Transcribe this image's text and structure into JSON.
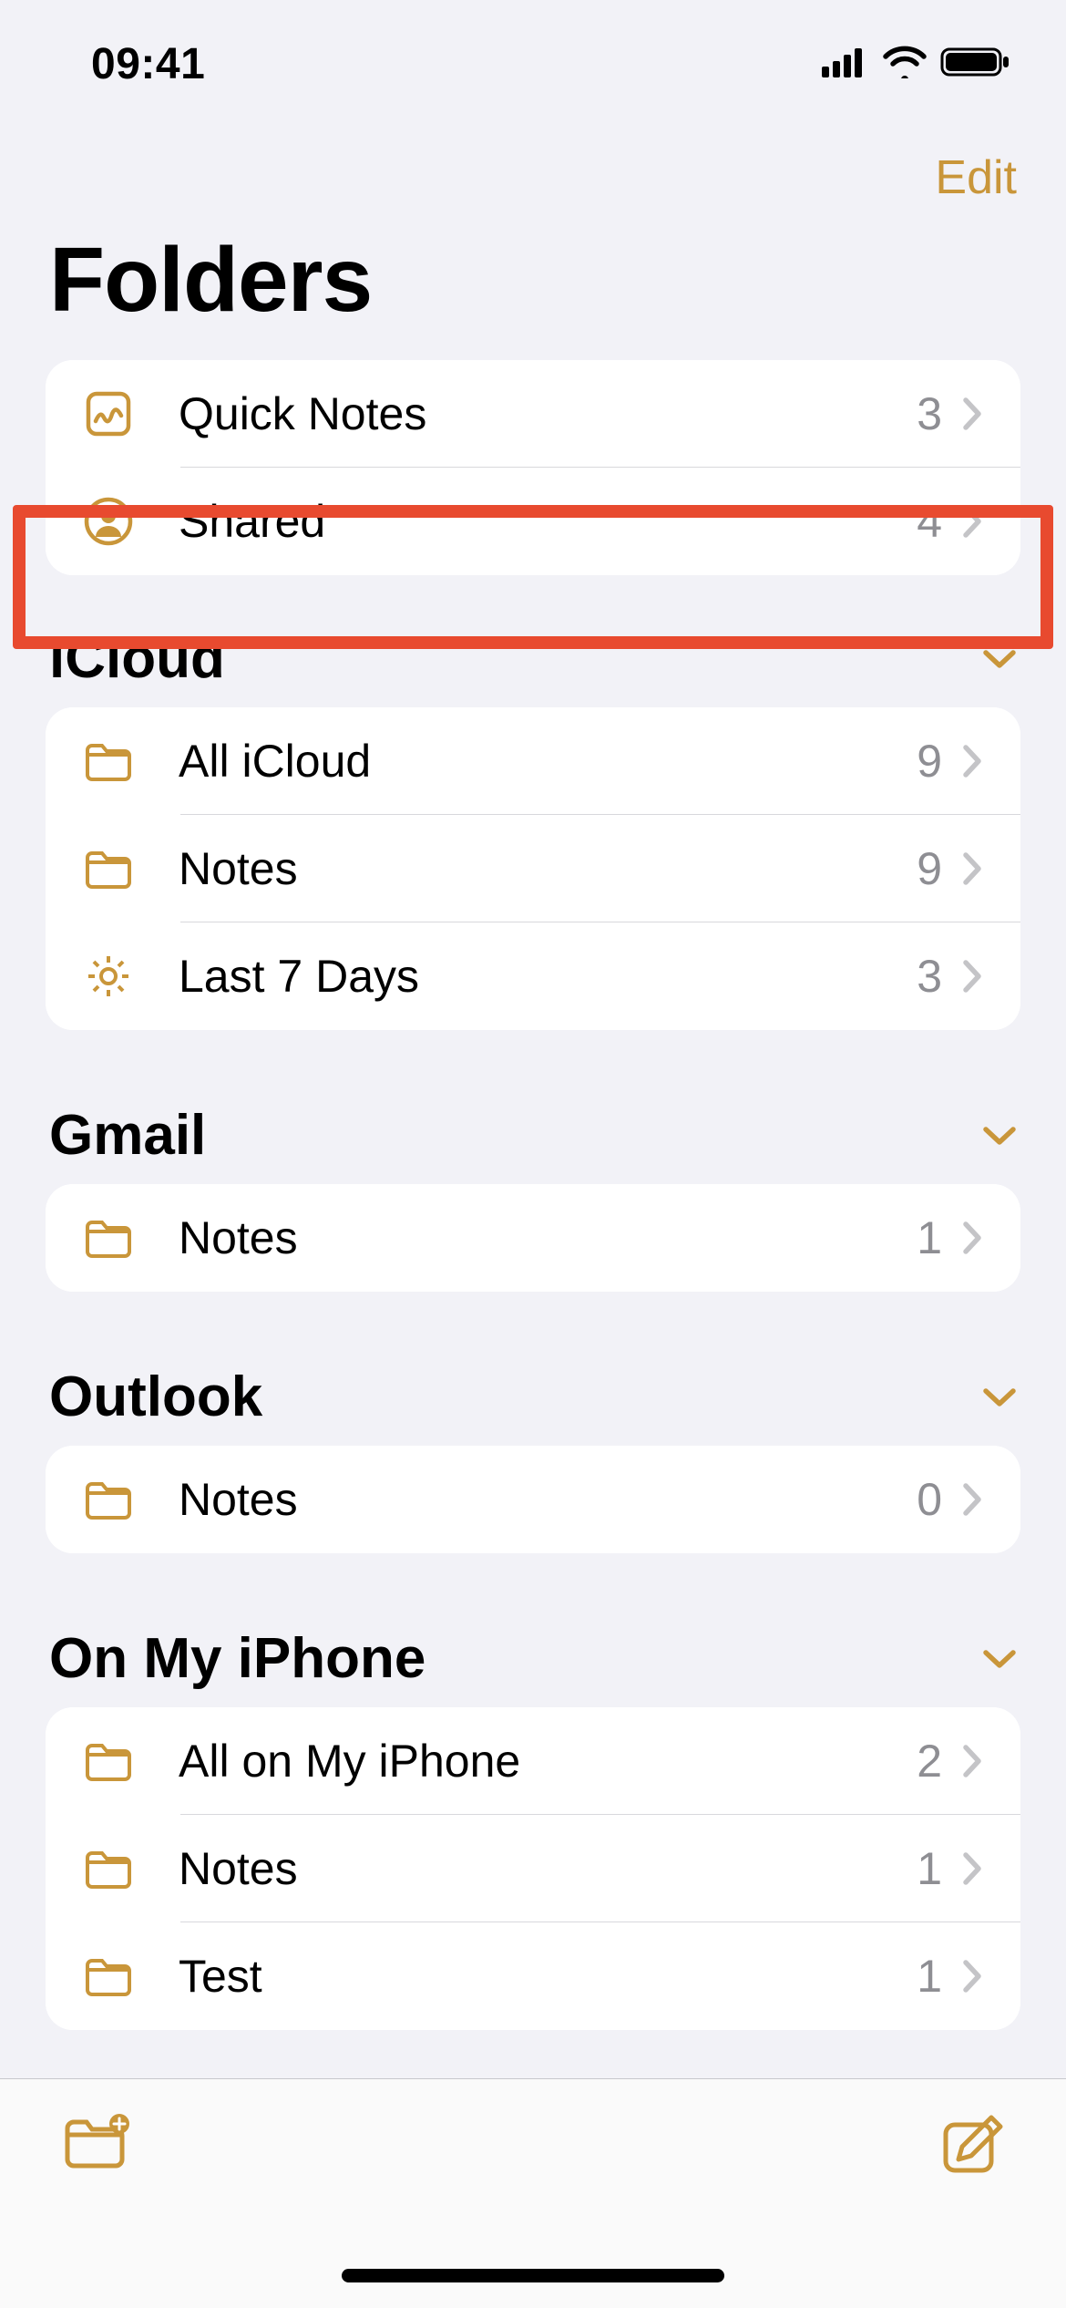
{
  "status": {
    "time": "09:41"
  },
  "nav": {
    "edit": "Edit"
  },
  "title": "Folders",
  "colors": {
    "accent": "#c9963a",
    "highlight": "#e84a2f"
  },
  "top_group": [
    {
      "icon": "quicknotes",
      "label": "Quick Notes",
      "count": "3"
    },
    {
      "icon": "person",
      "label": "Shared",
      "count": "4",
      "highlighted": true
    }
  ],
  "sections": [
    {
      "title": "iCloud",
      "items": [
        {
          "icon": "folder",
          "label": "All iCloud",
          "count": "9"
        },
        {
          "icon": "folder",
          "label": "Notes",
          "count": "9"
        },
        {
          "icon": "gear",
          "label": "Last 7 Days",
          "count": "3"
        }
      ]
    },
    {
      "title": "Gmail",
      "items": [
        {
          "icon": "folder",
          "label": "Notes",
          "count": "1"
        }
      ]
    },
    {
      "title": "Outlook",
      "items": [
        {
          "icon": "folder",
          "label": "Notes",
          "count": "0"
        }
      ]
    },
    {
      "title": "On My iPhone",
      "items": [
        {
          "icon": "folder",
          "label": "All on My iPhone",
          "count": "2"
        },
        {
          "icon": "folder",
          "label": "Notes",
          "count": "1"
        },
        {
          "icon": "folder",
          "label": "Test",
          "count": "1"
        }
      ]
    }
  ]
}
